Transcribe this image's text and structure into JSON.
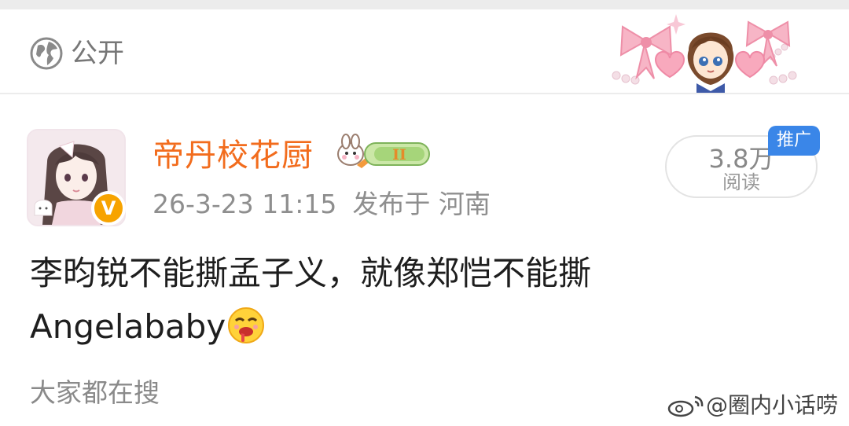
{
  "privacy": {
    "icon": "globe-icon",
    "label": "公开"
  },
  "post": {
    "username": "帝丹校花厨",
    "user_badge": "II",
    "timestamp": "26-3-23 11:15",
    "location": "发布于 河南",
    "reads_count": "3.8万",
    "reads_label": "阅读",
    "promo_tag": "推广",
    "text_line1": "李昀锐不能撕孟子义，就像郑恺不能撕",
    "text_line2": "Angelababy",
    "emoji": "drooling-emoji",
    "verified_badge": "V"
  },
  "footer": {
    "search_hint": "大家都在搜"
  },
  "watermark": {
    "text": "@圈内小话唠"
  },
  "colors": {
    "username": "#f26c1d",
    "verified": "#f7a300",
    "promo": "#3a86e8",
    "muted": "#8e8e8e"
  }
}
